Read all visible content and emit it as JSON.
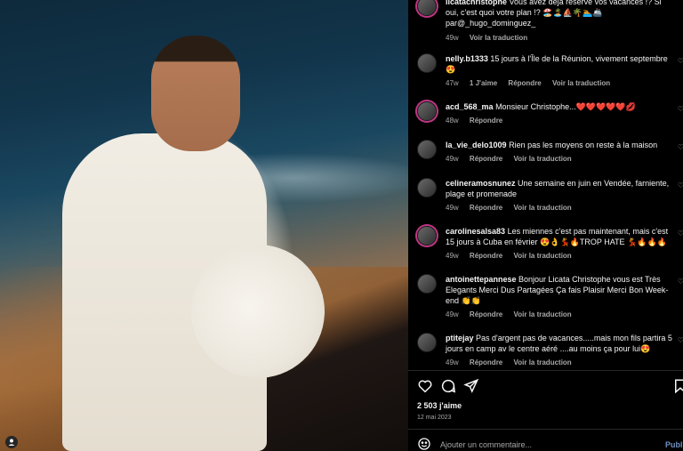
{
  "post": {
    "likes": "2 503 j'aime",
    "date": "12 mai 2023"
  },
  "caption": {
    "user": "licatachristophe",
    "text": "Vous avez déjà réservé vos vacances !? Si oui, c'est quoi votre plan !? 🏖️🏝️⛵🌴🏊🚢 par@_hugo_dominguez_",
    "time": "49w",
    "translate": "Voir la traduction"
  },
  "comments": [
    {
      "user": "nelly.b1333",
      "text": "15 jours à l'Île de la Réunion, vivement septembre 😍",
      "time": "47w",
      "likes": "1 J'aime",
      "reply": "Répondre",
      "translate": "Voir la traduction"
    },
    {
      "user": "acd_568_ma",
      "text": "Monsieur Christophe...❤️❤️❤️❤️❤️💋",
      "time": "48w",
      "reply": "Répondre"
    },
    {
      "user": "la_vie_delo1009",
      "text": "Rien pas les moyens on reste à la maison",
      "time": "49w",
      "reply": "Répondre",
      "translate": "Voir la traduction"
    },
    {
      "user": "celineramosnunez",
      "text": "Une semaine en juin en Vendée, farniente, plage et promenade",
      "time": "49w",
      "reply": "Répondre",
      "translate": "Voir la traduction"
    },
    {
      "user": "carolinesalsa83",
      "text": "Les miennes c'est pas maintenant, mais c'est 15 jours à Cuba en février 😍👌💃🔥TROP HATE 💃🔥🔥🔥",
      "time": "49w",
      "reply": "Répondre",
      "translate": "Voir la traduction"
    },
    {
      "user": "antoinettepannese",
      "text": "Bonjour Licata Christophe vous est Très Elegants Merci Dus Partagées Ça fais Plaisir Merci Bon Week-end 👏👏",
      "time": "49w",
      "reply": "Répondre",
      "translate": "Voir la traduction"
    },
    {
      "user": "ptitejay",
      "text": "Pas d'argent pas de vacances.....mais mon fils partira 5 jours en camp av le centre aéré ....au moins ça pour lui😍",
      "time": "49w",
      "reply": "Répondre",
      "translate": "Voir la traduction"
    }
  ],
  "input": {
    "placeholder": "Ajouter un commentaire...",
    "post_label": "Publier"
  },
  "icons": {
    "like": "heart-icon",
    "comment": "comment-icon",
    "share": "share-icon",
    "save": "bookmark-icon",
    "emoji": "emoji-icon",
    "tag": "user-tag-icon"
  }
}
